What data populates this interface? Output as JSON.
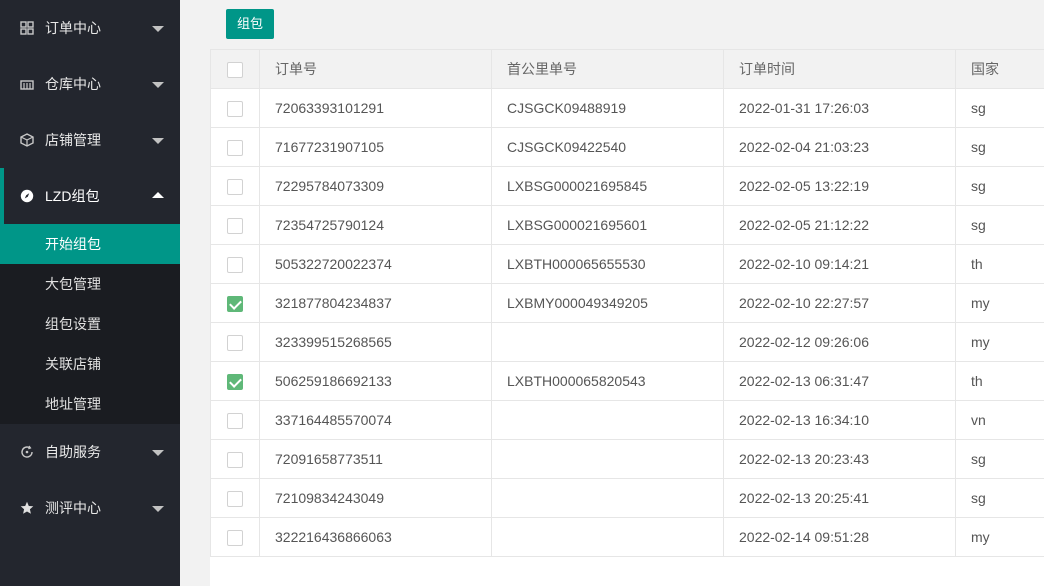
{
  "sidebar": {
    "groups": [
      {
        "label": "订单中心",
        "icon": "grid-icon"
      },
      {
        "label": "仓库中心",
        "icon": "warehouse-icon"
      },
      {
        "label": "店铺管理",
        "icon": "box-icon"
      },
      {
        "label": "LZD组包",
        "icon": "compass-icon",
        "expanded": true
      },
      {
        "label": "自助服务",
        "icon": "service-icon"
      },
      {
        "label": "测评中心",
        "icon": "star-icon"
      }
    ],
    "subitems": [
      "开始组包",
      "大包管理",
      "组包设置",
      "关联店铺",
      "地址管理"
    ],
    "selected_subitem": "开始组包"
  },
  "toolbar": {
    "pack_button": "组包"
  },
  "table": {
    "headers": [
      "订单号",
      "首公里单号",
      "订单时间",
      "国家"
    ],
    "rows": [
      {
        "checked": false,
        "order": "72063393101291",
        "first_mile": "CJSGCK09488919",
        "time": "2022-01-31 17:26:03",
        "country": "sg"
      },
      {
        "checked": false,
        "order": "71677231907105",
        "first_mile": "CJSGCK09422540",
        "time": "2022-02-04 21:03:23",
        "country": "sg"
      },
      {
        "checked": false,
        "order": "72295784073309",
        "first_mile": "LXBSG000021695845",
        "time": "2022-02-05 13:22:19",
        "country": "sg"
      },
      {
        "checked": false,
        "order": "72354725790124",
        "first_mile": "LXBSG000021695601",
        "time": "2022-02-05 21:12:22",
        "country": "sg"
      },
      {
        "checked": false,
        "order": "505322720022374",
        "first_mile": "LXBTH000065655530",
        "time": "2022-02-10 09:14:21",
        "country": "th"
      },
      {
        "checked": true,
        "order": "321877804234837",
        "first_mile": "LXBMY000049349205",
        "time": "2022-02-10 22:27:57",
        "country": "my"
      },
      {
        "checked": false,
        "order": "323399515268565",
        "first_mile": "",
        "time": "2022-02-12 09:26:06",
        "country": "my"
      },
      {
        "checked": true,
        "order": "506259186692133",
        "first_mile": "LXBTH000065820543",
        "time": "2022-02-13 06:31:47",
        "country": "th"
      },
      {
        "checked": false,
        "order": "337164485570074",
        "first_mile": "",
        "time": "2022-02-13 16:34:10",
        "country": "vn"
      },
      {
        "checked": false,
        "order": "72091658773511",
        "first_mile": "",
        "time": "2022-02-13 20:23:43",
        "country": "sg"
      },
      {
        "checked": false,
        "order": "72109834243049",
        "first_mile": "",
        "time": "2022-02-13 20:25:41",
        "country": "sg"
      },
      {
        "checked": false,
        "order": "322216436866063",
        "first_mile": "",
        "time": "2022-02-14 09:51:28",
        "country": "my"
      }
    ]
  }
}
